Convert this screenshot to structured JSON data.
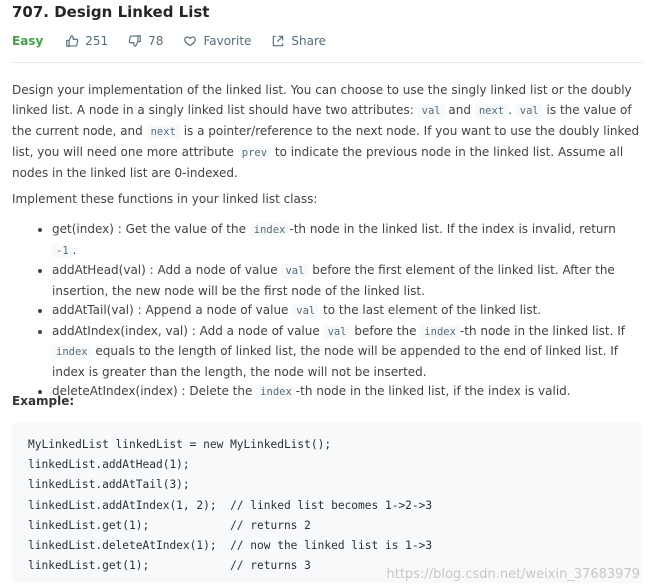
{
  "problem": {
    "title": "707. Design Linked List",
    "difficulty": "Easy",
    "likes": "251",
    "dislikes": "78",
    "favorite_label": "Favorite",
    "share_label": "Share"
  },
  "description": {
    "p1": [
      "Design your implementation of the linked list. You can choose to use the singly linked list or the doubly linked list. A node in a singly linked list should have two attributes: ",
      "val",
      " and ",
      "next",
      ". ",
      "val",
      " is the value of the current node, and ",
      "next",
      " is a pointer/reference to the next node. If you want to use the doubly linked list, you will need one more attribute ",
      "prev",
      " to indicate the previous node in the linked list. Assume all nodes in the linked list are 0-indexed."
    ],
    "p2": "Implement these functions in your linked list class:"
  },
  "functions": [
    [
      "get(index) : Get the value of the ",
      "index",
      "-th node in the linked list. If the index is invalid, return ",
      "-1",
      "."
    ],
    [
      "addAtHead(val) : Add a node of value ",
      "val",
      " before the first element of the linked list. After the insertion, the new node will be the first node of the linked list."
    ],
    [
      "addAtTail(val) : Append a node of value ",
      "val",
      " to the last element of the linked list."
    ],
    [
      "addAtIndex(index, val) : Add a node of value ",
      "val",
      " before the ",
      "index",
      "-th node in the linked list. If ",
      "index",
      " equals to the length of linked list, the node will be appended to the end of linked list. If index is greater than the length, the node will not be inserted."
    ],
    [
      "deleteAtIndex(index) : Delete the ",
      "index",
      "-th node in the linked list, if the index is valid."
    ]
  ],
  "example": {
    "label": "Example:",
    "code_lines": [
      "MyLinkedList linkedList = new MyLinkedList();",
      "linkedList.addAtHead(1);",
      "linkedList.addAtTail(3);",
      "linkedList.addAtIndex(1, 2);  // linked list becomes 1->2->3",
      "linkedList.get(1);            // returns 2",
      "linkedList.deleteAtIndex(1);  // now the linked list is 1->3",
      "linkedList.get(1);            // returns 3"
    ]
  },
  "watermark": "https://blog.csdn.net/weixin_37683979",
  "icons": {
    "like": "thumbs-up-icon",
    "dislike": "thumbs-down-icon",
    "favorite": "heart-icon",
    "share": "share-icon"
  },
  "colors": {
    "difficulty_easy": "#43a047",
    "code_background": "#f7f9fa",
    "inline_code_text": "#546e7a"
  }
}
